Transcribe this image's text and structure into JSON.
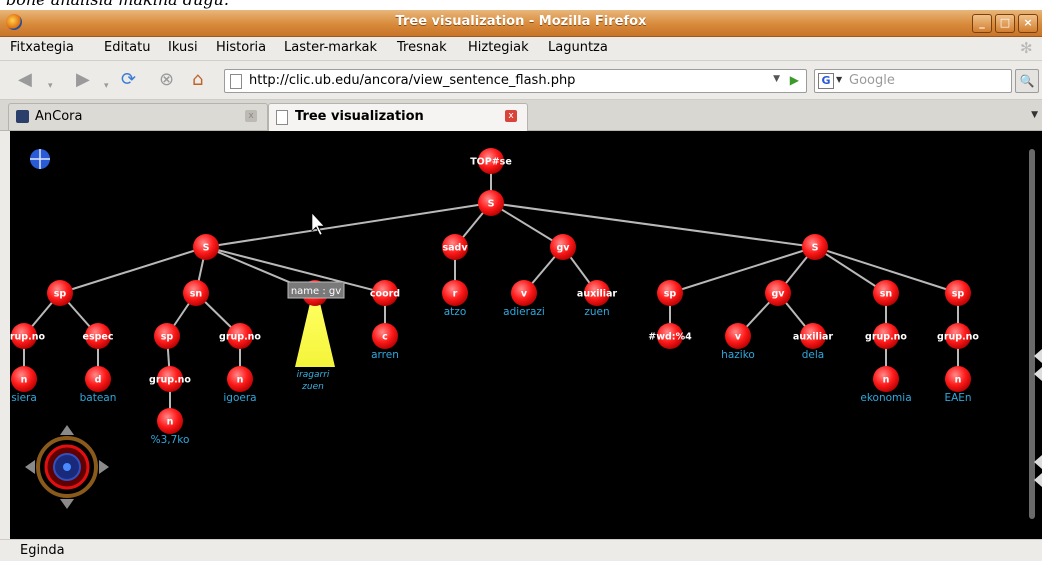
{
  "caption": {
    "text": "bone analisia makina dugu."
  },
  "window": {
    "title": "Tree visualization - Mozilla Firefox"
  },
  "menu": {
    "items": [
      "Fitxategia",
      "Editatu",
      "Ikusi",
      "Historia",
      "Laster-markak",
      "Tresnak",
      "Hiztegiak",
      "Laguntza"
    ]
  },
  "nav": {
    "url": "http://clic.ub.edu/ancora/view_sentence_flash.php",
    "search_placeholder": "Google"
  },
  "tabs": [
    {
      "label": "AnCora",
      "active": false
    },
    {
      "label": "Tree visualization",
      "active": true
    }
  ],
  "tree": {
    "tooltip": "name : gv",
    "nodes": [
      {
        "id": "top",
        "label": "TOP#se"
      },
      {
        "id": "s_root",
        "label": "S",
        "parent": "top"
      },
      {
        "id": "s1",
        "label": "S",
        "parent": "s_root"
      },
      {
        "id": "sadv",
        "label": "sadv",
        "parent": "s_root"
      },
      {
        "id": "gv1",
        "label": "gv",
        "parent": "s_root"
      },
      {
        "id": "s2",
        "label": "S",
        "parent": "s_root"
      },
      {
        "id": "sp1",
        "label": "sp",
        "parent": "s1"
      },
      {
        "id": "sn1",
        "label": "sn",
        "parent": "s1"
      },
      {
        "id": "gvsel",
        "label": "",
        "parent": "s1",
        "selected": true
      },
      {
        "id": "coord",
        "label": "coord",
        "parent": "s1"
      },
      {
        "id": "grupno1",
        "label": "grup.no",
        "parent": "sp1"
      },
      {
        "id": "espec",
        "label": "espec",
        "parent": "sp1"
      },
      {
        "id": "n_siera",
        "label": "n",
        "parent": "grupno1",
        "word": "siera"
      },
      {
        "id": "d_batean",
        "label": "d",
        "parent": "espec",
        "word": "batean"
      },
      {
        "id": "sp2",
        "label": "sp",
        "parent": "sn1"
      },
      {
        "id": "grupno2",
        "label": "grup.no",
        "parent": "sn1"
      },
      {
        "id": "grupno3",
        "label": "grup.no",
        "parent": "sp2"
      },
      {
        "id": "n_37ko",
        "label": "n",
        "parent": "grupno3",
        "word": "%3,7ko"
      },
      {
        "id": "n_igoera",
        "label": "n",
        "parent": "grupno2",
        "word": "igoera"
      },
      {
        "id": "c_arren",
        "label": "c",
        "parent": "coord",
        "word": "arren"
      },
      {
        "id": "r_atzo",
        "label": "r",
        "parent": "sadv",
        "word": "atzo"
      },
      {
        "id": "v_adierazi",
        "label": "v",
        "parent": "gv1",
        "word": "adierazi"
      },
      {
        "id": "aux1",
        "label": "auxiliar",
        "parent": "gv1",
        "word": "zuen"
      },
      {
        "id": "sp3",
        "label": "sp",
        "parent": "s2"
      },
      {
        "id": "gv2",
        "label": "gv",
        "parent": "s2"
      },
      {
        "id": "sn2",
        "label": "sn",
        "parent": "s2"
      },
      {
        "id": "sp4",
        "label": "sp",
        "parent": "s2"
      },
      {
        "id": "wd",
        "label": "#wd:%4",
        "parent": "sp3"
      },
      {
        "id": "v_haziko",
        "label": "v",
        "parent": "gv2",
        "word": "haziko"
      },
      {
        "id": "aux2",
        "label": "auxiliar",
        "parent": "gv2",
        "word": "dela"
      },
      {
        "id": "grupno4",
        "label": "grup.no",
        "parent": "sn2"
      },
      {
        "id": "grupno5",
        "label": "grup.no",
        "parent": "sp4"
      },
      {
        "id": "n_ekonomia",
        "label": "n",
        "parent": "grupno4",
        "word": "ekonomia"
      },
      {
        "id": "n_eaen",
        "label": "n",
        "parent": "grupno5",
        "word": "EAEn"
      }
    ],
    "selected_words": [
      "iragarri",
      "zuen"
    ]
  },
  "status": {
    "text": "Eginda"
  }
}
